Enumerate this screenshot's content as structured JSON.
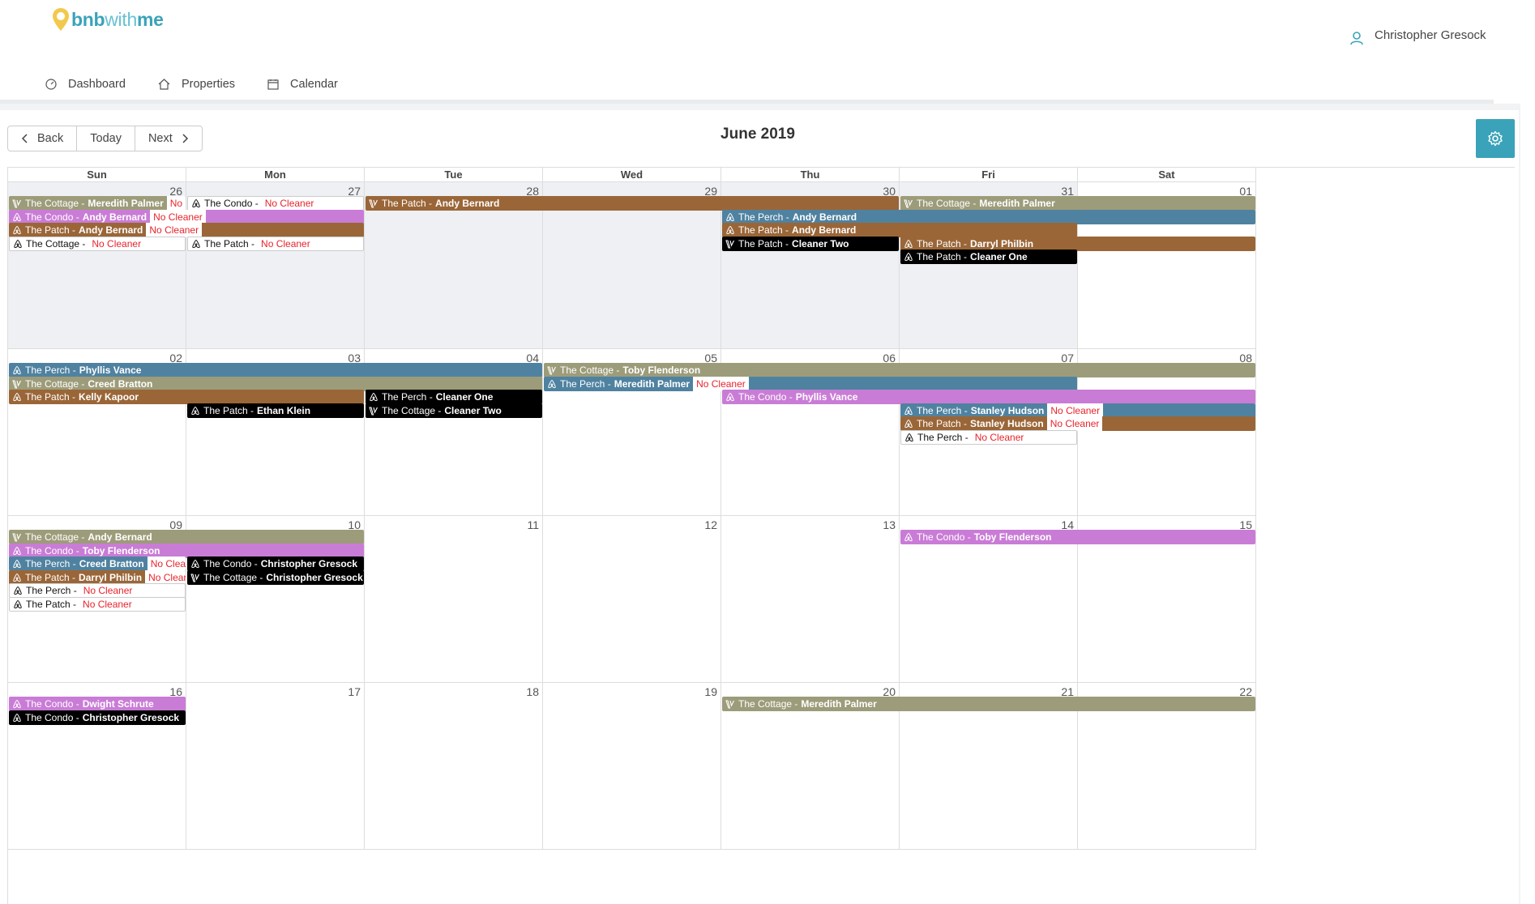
{
  "brand": {
    "name_part1": "bnb",
    "name_part2": "with",
    "name_part3": "me"
  },
  "user": {
    "name": "Christopher Gresock"
  },
  "nav": [
    {
      "label": "Dashboard",
      "icon": "gauge-icon"
    },
    {
      "label": "Properties",
      "icon": "home-icon"
    },
    {
      "label": "Calendar",
      "icon": "calendar-icon"
    }
  ],
  "toolbar": {
    "back_label": "Back",
    "today_label": "Today",
    "next_label": "Next",
    "month_title": "June 2019"
  },
  "weekdays": [
    "Sun",
    "Mon",
    "Tue",
    "Wed",
    "Thu",
    "Fri",
    "Sat"
  ],
  "weeks": [
    {
      "days": [
        {
          "num": "26",
          "off": true
        },
        {
          "num": "27",
          "off": true
        },
        {
          "num": "28",
          "off": true
        },
        {
          "num": "29",
          "off": true
        },
        {
          "num": "30",
          "off": true
        },
        {
          "num": "31",
          "off": true
        },
        {
          "num": "01",
          "off": false
        }
      ],
      "events": [
        {
          "start": 0,
          "span": 1,
          "row": 0,
          "color": "cottage",
          "icon": "vrbo",
          "prop": "The Cottage -",
          "who": "Meredith Palmer",
          "tag": "No Cleaner"
        },
        {
          "start": 1,
          "span": 1,
          "row": 0,
          "color": "white",
          "icon": "airbnb",
          "prop": "The Condo -",
          "who": "",
          "tag": "No Cleaner"
        },
        {
          "start": 2,
          "span": 3,
          "row": 0,
          "color": "patch",
          "icon": "vrbo",
          "prop": "The Patch -",
          "who": "Andy Bernard",
          "tag": ""
        },
        {
          "start": 5,
          "span": 2,
          "row": 0,
          "color": "cottage",
          "icon": "vrbo",
          "prop": "The Cottage -",
          "who": "Meredith Palmer",
          "tag": ""
        },
        {
          "start": 0,
          "span": 2,
          "row": 1,
          "color": "condo",
          "icon": "airbnb",
          "prop": "The Condo -",
          "who": "Andy Bernard",
          "tag": "No Cleaner"
        },
        {
          "start": 4,
          "span": 3,
          "row": 1,
          "color": "perch",
          "icon": "airbnb",
          "prop": "The Perch -",
          "who": "Andy Bernard",
          "tag": ""
        },
        {
          "start": 0,
          "span": 2,
          "row": 2,
          "color": "patch",
          "icon": "airbnb",
          "prop": "The Patch -",
          "who": "Andy Bernard",
          "tag": "No Cleaner"
        },
        {
          "start": 4,
          "span": 2,
          "row": 2,
          "color": "patch",
          "icon": "airbnb",
          "prop": "The Patch -",
          "who": "Andy Bernard",
          "tag": ""
        },
        {
          "start": 0,
          "span": 1,
          "row": 3,
          "color": "white",
          "icon": "airbnb",
          "prop": "The Cottage -",
          "who": "",
          "tag": "No Cleaner"
        },
        {
          "start": 1,
          "span": 1,
          "row": 3,
          "color": "white",
          "icon": "airbnb",
          "prop": "The Patch -",
          "who": "",
          "tag": "No Cleaner"
        },
        {
          "start": 4,
          "span": 1,
          "row": 3,
          "color": "black",
          "icon": "vrbo",
          "prop": "The Patch -",
          "who": "Cleaner Two",
          "tag": ""
        },
        {
          "start": 5,
          "span": 2,
          "row": 3,
          "color": "patch",
          "icon": "airbnb",
          "prop": "The Patch -",
          "who": "Darryl Philbin",
          "tag": ""
        },
        {
          "start": 5,
          "span": 1,
          "row": 4,
          "color": "black",
          "icon": "airbnb",
          "prop": "The Patch -",
          "who": "Cleaner One",
          "tag": ""
        }
      ]
    },
    {
      "days": [
        {
          "num": "02",
          "off": false
        },
        {
          "num": "03",
          "off": false
        },
        {
          "num": "04",
          "off": false
        },
        {
          "num": "05",
          "off": false
        },
        {
          "num": "06",
          "off": false
        },
        {
          "num": "07",
          "off": false
        },
        {
          "num": "08",
          "off": false
        }
      ],
      "events": [
        {
          "start": 0,
          "span": 3,
          "row": 0,
          "color": "perch",
          "icon": "airbnb",
          "prop": "The Perch -",
          "who": "Phyllis Vance",
          "tag": ""
        },
        {
          "start": 3,
          "span": 4,
          "row": 0,
          "color": "cottage",
          "icon": "vrbo",
          "prop": "The Cottage -",
          "who": "Toby Flenderson",
          "tag": ""
        },
        {
          "start": 0,
          "span": 3,
          "row": 1,
          "color": "cottage",
          "icon": "vrbo",
          "prop": "The Cottage -",
          "who": "Creed Bratton",
          "tag": ""
        },
        {
          "start": 3,
          "span": 3,
          "row": 1,
          "color": "perch",
          "icon": "airbnb",
          "prop": "The Perch -",
          "who": "Meredith Palmer",
          "tag": "No Cleaner"
        },
        {
          "start": 0,
          "span": 2,
          "row": 2,
          "color": "patch",
          "icon": "airbnb",
          "prop": "The Patch -",
          "who": "Kelly Kapoor",
          "tag": ""
        },
        {
          "start": 2,
          "span": 1,
          "row": 2,
          "color": "black",
          "icon": "airbnb",
          "prop": "The Perch -",
          "who": "Cleaner One",
          "tag": ""
        },
        {
          "start": 4,
          "span": 3,
          "row": 2,
          "color": "condo",
          "icon": "airbnb",
          "prop": "The Condo -",
          "who": "Phyllis Vance",
          "tag": ""
        },
        {
          "start": 1,
          "span": 1,
          "row": 3,
          "color": "black",
          "icon": "airbnb",
          "prop": "The Patch -",
          "who": "Ethan Klein",
          "tag": ""
        },
        {
          "start": 2,
          "span": 1,
          "row": 3,
          "color": "black",
          "icon": "vrbo",
          "prop": "The Cottage -",
          "who": "Cleaner Two",
          "tag": ""
        },
        {
          "start": 5,
          "span": 2,
          "row": 3,
          "color": "perch",
          "icon": "airbnb",
          "prop": "The Perch -",
          "who": "Stanley Hudson",
          "tag": "No Cleaner"
        },
        {
          "start": 5,
          "span": 2,
          "row": 4,
          "color": "patch",
          "icon": "airbnb",
          "prop": "The Patch -",
          "who": "Stanley Hudson",
          "tag": "No Cleaner"
        },
        {
          "start": 5,
          "span": 1,
          "row": 5,
          "color": "white",
          "icon": "airbnb",
          "prop": "The Perch -",
          "who": "",
          "tag": "No Cleaner"
        }
      ]
    },
    {
      "days": [
        {
          "num": "09",
          "off": false
        },
        {
          "num": "10",
          "off": false
        },
        {
          "num": "11",
          "off": false
        },
        {
          "num": "12",
          "off": false
        },
        {
          "num": "13",
          "off": false
        },
        {
          "num": "14",
          "off": false
        },
        {
          "num": "15",
          "off": false
        }
      ],
      "events": [
        {
          "start": 0,
          "span": 2,
          "row": 0,
          "color": "cottage",
          "icon": "vrbo",
          "prop": "The Cottage -",
          "who": "Andy Bernard",
          "tag": ""
        },
        {
          "start": 5,
          "span": 2,
          "row": 0,
          "color": "condo",
          "icon": "airbnb",
          "prop": "The Condo -",
          "who": "Toby Flenderson",
          "tag": ""
        },
        {
          "start": 0,
          "span": 2,
          "row": 1,
          "color": "condo",
          "icon": "airbnb",
          "prop": "The Condo -",
          "who": "Toby Flenderson",
          "tag": ""
        },
        {
          "start": 0,
          "span": 1,
          "row": 2,
          "color": "perch",
          "icon": "airbnb",
          "prop": "The Perch -",
          "who": "Creed Bratton",
          "tag": "No Cleaner"
        },
        {
          "start": 1,
          "span": 1,
          "row": 2,
          "color": "black",
          "icon": "airbnb",
          "prop": "The Condo -",
          "who": "Christopher Gresock",
          "tag": ""
        },
        {
          "start": 0,
          "span": 1,
          "row": 3,
          "color": "patch",
          "icon": "airbnb",
          "prop": "The Patch -",
          "who": "Darryl Philbin",
          "tag": "No Cleaner"
        },
        {
          "start": 1,
          "span": 1,
          "row": 3,
          "color": "black",
          "icon": "vrbo",
          "prop": "The Cottage -",
          "who": "Christopher Gresock",
          "tag": ""
        },
        {
          "start": 0,
          "span": 1,
          "row": 4,
          "color": "white",
          "icon": "airbnb",
          "prop": "The Perch -",
          "who": "",
          "tag": "No Cleaner"
        },
        {
          "start": 0,
          "span": 1,
          "row": 5,
          "color": "white",
          "icon": "airbnb",
          "prop": "The Patch -",
          "who": "",
          "tag": "No Cleaner"
        }
      ]
    },
    {
      "days": [
        {
          "num": "16",
          "off": false
        },
        {
          "num": "17",
          "off": false
        },
        {
          "num": "18",
          "off": false
        },
        {
          "num": "19",
          "off": false
        },
        {
          "num": "20",
          "off": false
        },
        {
          "num": "21",
          "off": false
        },
        {
          "num": "22",
          "off": false
        }
      ],
      "events": [
        {
          "start": 0,
          "span": 1,
          "row": 0,
          "color": "condo",
          "icon": "airbnb",
          "prop": "The Condo -",
          "who": "Dwight Schrute",
          "tag": ""
        },
        {
          "start": 4,
          "span": 3,
          "row": 0,
          "color": "cottage",
          "icon": "vrbo",
          "prop": "The Cottage -",
          "who": "Meredith Palmer",
          "tag": ""
        },
        {
          "start": 0,
          "span": 1,
          "row": 1,
          "color": "black",
          "icon": "airbnb",
          "prop": "The Condo -",
          "who": "Christopher Gresock",
          "tag": ""
        }
      ]
    }
  ],
  "colors": {
    "accent": "#3aa3b9",
    "cottage": "#9d9c7a",
    "condo": "#c97cd6",
    "patch": "#9a6638",
    "perch": "#4f82a0",
    "no_cleaner": "#e8232b"
  }
}
